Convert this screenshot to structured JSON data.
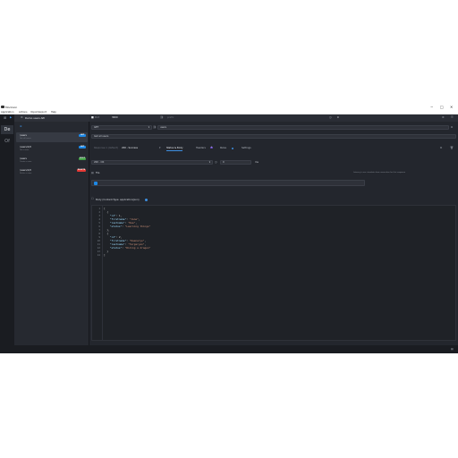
{
  "window": {
    "title": "Mockoon",
    "controls": {
      "minimize": "−",
      "maximize": "□",
      "close": "✕"
    }
  },
  "menubar": [
    "Application",
    "Actions",
    "Import/export",
    "Help"
  ],
  "left_nav": [
    {
      "label": "De",
      "active": true
    },
    {
      "label": "Of",
      "active": false
    }
  ],
  "sidebar": {
    "environment_name": "Demo users API",
    "routes": [
      {
        "name": "/users",
        "subtitle": "Get all users",
        "method": "GET",
        "method_color": "#1e88e5",
        "selected": true
      },
      {
        "name": "/users/1/0",
        "subtitle": "Get a user",
        "method": "GET",
        "method_color": "#1e88e5",
        "selected": false
      },
      {
        "name": "/users",
        "subtitle": "Create a user",
        "method": "POST",
        "method_color": "#43a047",
        "selected": false
      },
      {
        "name": "/users/1/0",
        "subtitle": "Delete a user",
        "method": "DELETE",
        "method_color": "#e53935",
        "selected": false
      }
    ]
  },
  "header_bar": {
    "port_label": "Port",
    "port_value": "3000",
    "prefix_placeholder": "prefix",
    "latency_value": "0"
  },
  "route": {
    "method": "GET",
    "path": "users",
    "documentation": "Get all users"
  },
  "response_selector": {
    "label": "Response 1 (default)",
    "status_summary": "200 - Success"
  },
  "tabs": [
    {
      "label": "Status & Body",
      "active": true
    },
    {
      "label": "Headers",
      "count": "1",
      "active": false
    },
    {
      "label": "Rules",
      "active": false
    },
    {
      "label": "Settings",
      "active": false
    }
  ],
  "status": {
    "code_label": "200 - OK",
    "latency": "0",
    "latency_unit": "ms",
    "hint": "Latency in ms: simulate slow connection for this response"
  },
  "file": {
    "label": "File",
    "placeholder": ""
  },
  "body": {
    "label": "Body (Content-Type: application/json)",
    "lines": [
      "[",
      "  {",
      "    \"id\": 1,",
      "    \"firstname\": \"Jane\",",
      "    \"lastname\": \"Doe\",",
      "    \"status\": \"Learning things\"",
      "  },",
      "  {",
      "    \"id\": 2,",
      "    \"firstname\": \"Daenerys\",",
      "    \"lastname\": \"Targaryen\",",
      "    \"status\": \"Riding a dragon\"",
      "  }",
      "]"
    ]
  },
  "colors": {
    "background": "#23262d",
    "sidebar": "#262930",
    "accent": "#3d8fe0",
    "get": "#1e88e5",
    "post": "#43a047",
    "delete": "#e53935"
  }
}
